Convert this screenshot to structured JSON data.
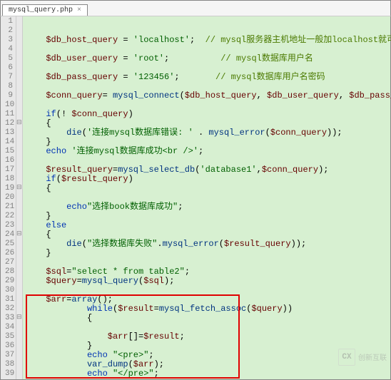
{
  "tab": {
    "label": "mysql_query.php",
    "close": "×"
  },
  "lines": [
    {
      "n": "1",
      "f": "",
      "segs": []
    },
    {
      "n": "2",
      "f": "",
      "segs": []
    },
    {
      "n": "3",
      "f": "",
      "segs": [
        {
          "t": "    ",
          "c": ""
        },
        {
          "t": "$db_host_query",
          "c": "c-var"
        },
        {
          "t": " = ",
          "c": "c-op"
        },
        {
          "t": "'localhost'",
          "c": "c-str"
        },
        {
          "t": ";  ",
          "c": "c-op"
        },
        {
          "t": "// mysql服务器主机地址一般加localhost就可以",
          "c": "c-cmt2"
        }
      ]
    },
    {
      "n": "4",
      "f": "",
      "segs": []
    },
    {
      "n": "5",
      "f": "",
      "segs": [
        {
          "t": "    ",
          "c": ""
        },
        {
          "t": "$db_user_query",
          "c": "c-var"
        },
        {
          "t": " = ",
          "c": "c-op"
        },
        {
          "t": "'root'",
          "c": "c-str"
        },
        {
          "t": ";          ",
          "c": "c-op"
        },
        {
          "t": "// mysql数据库用户名",
          "c": "c-cmt2"
        }
      ]
    },
    {
      "n": "6",
      "f": "",
      "segs": []
    },
    {
      "n": "7",
      "f": "",
      "segs": [
        {
          "t": "    ",
          "c": ""
        },
        {
          "t": "$db_pass_query",
          "c": "c-var"
        },
        {
          "t": " = ",
          "c": "c-op"
        },
        {
          "t": "'123456'",
          "c": "c-str"
        },
        {
          "t": ";       ",
          "c": "c-op"
        },
        {
          "t": "// mysql数据库用户名密码",
          "c": "c-cmt2"
        }
      ]
    },
    {
      "n": "8",
      "f": "",
      "segs": []
    },
    {
      "n": "9",
      "f": "",
      "segs": [
        {
          "t": "    ",
          "c": ""
        },
        {
          "t": "$conn_query",
          "c": "c-var"
        },
        {
          "t": "= ",
          "c": "c-op"
        },
        {
          "t": "mysql_connect",
          "c": "c-fn"
        },
        {
          "t": "(",
          "c": "c-op"
        },
        {
          "t": "$db_host_query",
          "c": "c-var"
        },
        {
          "t": ", ",
          "c": "c-op"
        },
        {
          "t": "$db_user_query",
          "c": "c-var"
        },
        {
          "t": ", ",
          "c": "c-op"
        },
        {
          "t": "$db_pass_query",
          "c": "c-var"
        },
        {
          "t": ");",
          "c": "c-op"
        }
      ]
    },
    {
      "n": "10",
      "f": "",
      "segs": []
    },
    {
      "n": "11",
      "f": "",
      "segs": [
        {
          "t": "    ",
          "c": ""
        },
        {
          "t": "if",
          "c": "c-kw"
        },
        {
          "t": "(! ",
          "c": "c-op"
        },
        {
          "t": "$conn_query",
          "c": "c-var"
        },
        {
          "t": ")",
          "c": "c-op"
        }
      ]
    },
    {
      "n": "12",
      "f": "⊟",
      "segs": [
        {
          "t": "    {",
          "c": "c-op"
        }
      ]
    },
    {
      "n": "13",
      "f": "",
      "segs": [
        {
          "t": "        ",
          "c": ""
        },
        {
          "t": "die",
          "c": "c-fn"
        },
        {
          "t": "(",
          "c": "c-op"
        },
        {
          "t": "'连接mysql数据库错误: '",
          "c": "c-str"
        },
        {
          "t": " . ",
          "c": "c-op"
        },
        {
          "t": "mysql_error",
          "c": "c-fn"
        },
        {
          "t": "(",
          "c": "c-op"
        },
        {
          "t": "$conn_query",
          "c": "c-var"
        },
        {
          "t": "));",
          "c": "c-op"
        }
      ]
    },
    {
      "n": "14",
      "f": "",
      "segs": [
        {
          "t": "    }",
          "c": "c-op"
        }
      ]
    },
    {
      "n": "15",
      "f": "",
      "segs": [
        {
          "t": "    ",
          "c": ""
        },
        {
          "t": "echo",
          "c": "c-kw"
        },
        {
          "t": " ",
          "c": ""
        },
        {
          "t": "'连接mysql数据库成功<br />'",
          "c": "c-str"
        },
        {
          "t": ";",
          "c": "c-op"
        }
      ]
    },
    {
      "n": "16",
      "f": "",
      "segs": []
    },
    {
      "n": "17",
      "f": "",
      "segs": [
        {
          "t": "    ",
          "c": ""
        },
        {
          "t": "$result_query",
          "c": "c-var"
        },
        {
          "t": "=",
          "c": "c-op"
        },
        {
          "t": "mysql_select_db",
          "c": "c-fn"
        },
        {
          "t": "(",
          "c": "c-op"
        },
        {
          "t": "'database1'",
          "c": "c-str"
        },
        {
          "t": ",",
          "c": "c-op"
        },
        {
          "t": "$conn_query",
          "c": "c-var"
        },
        {
          "t": ");",
          "c": "c-op"
        }
      ]
    },
    {
      "n": "18",
      "f": "",
      "segs": [
        {
          "t": "    ",
          "c": ""
        },
        {
          "t": "if",
          "c": "c-kw"
        },
        {
          "t": "(",
          "c": "c-op"
        },
        {
          "t": "$result_query",
          "c": "c-var"
        },
        {
          "t": ")",
          "c": "c-op"
        }
      ]
    },
    {
      "n": "19",
      "f": "⊟",
      "segs": [
        {
          "t": "    {",
          "c": "c-op"
        }
      ]
    },
    {
      "n": "20",
      "f": "",
      "segs": []
    },
    {
      "n": "21",
      "f": "",
      "segs": [
        {
          "t": "        ",
          "c": ""
        },
        {
          "t": "echo",
          "c": "c-kw"
        },
        {
          "t": "\"选择book数据库成功\"",
          "c": "c-str"
        },
        {
          "t": ";",
          "c": "c-op"
        }
      ]
    },
    {
      "n": "22",
      "f": "",
      "segs": [
        {
          "t": "    }",
          "c": "c-op"
        }
      ]
    },
    {
      "n": "23",
      "f": "",
      "segs": [
        {
          "t": "    ",
          "c": ""
        },
        {
          "t": "else",
          "c": "c-kw"
        }
      ]
    },
    {
      "n": "24",
      "f": "⊟",
      "segs": [
        {
          "t": "    {",
          "c": "c-op"
        }
      ]
    },
    {
      "n": "25",
      "f": "",
      "segs": [
        {
          "t": "        ",
          "c": ""
        },
        {
          "t": "die",
          "c": "c-fn"
        },
        {
          "t": "(",
          "c": "c-op"
        },
        {
          "t": "\"选择数据库失败\"",
          "c": "c-str"
        },
        {
          "t": ".",
          "c": "c-op"
        },
        {
          "t": "mysql_error",
          "c": "c-fn"
        },
        {
          "t": "(",
          "c": "c-op"
        },
        {
          "t": "$result_query",
          "c": "c-var"
        },
        {
          "t": "));",
          "c": "c-op"
        }
      ]
    },
    {
      "n": "26",
      "f": "",
      "segs": [
        {
          "t": "    }",
          "c": "c-op"
        }
      ]
    },
    {
      "n": "27",
      "f": "",
      "segs": []
    },
    {
      "n": "28",
      "f": "",
      "segs": [
        {
          "t": "    ",
          "c": ""
        },
        {
          "t": "$sql",
          "c": "c-var"
        },
        {
          "t": "=",
          "c": "c-op"
        },
        {
          "t": "\"select * from table2\"",
          "c": "c-str"
        },
        {
          "t": ";",
          "c": "c-op"
        }
      ]
    },
    {
      "n": "29",
      "f": "",
      "segs": [
        {
          "t": "    ",
          "c": ""
        },
        {
          "t": "$query",
          "c": "c-var"
        },
        {
          "t": "=",
          "c": "c-op"
        },
        {
          "t": "mysql_query",
          "c": "c-fn"
        },
        {
          "t": "(",
          "c": "c-op"
        },
        {
          "t": "$sql",
          "c": "c-var"
        },
        {
          "t": ");",
          "c": "c-op"
        }
      ]
    },
    {
      "n": "30",
      "f": "",
      "segs": []
    },
    {
      "n": "31",
      "f": "",
      "segs": [
        {
          "t": "    ",
          "c": ""
        },
        {
          "t": "$arr",
          "c": "c-var"
        },
        {
          "t": "=",
          "c": "c-op"
        },
        {
          "t": "array",
          "c": "c-fn"
        },
        {
          "t": "();",
          "c": "c-op"
        }
      ]
    },
    {
      "n": "32",
      "f": "",
      "segs": [
        {
          "t": "            ",
          "c": ""
        },
        {
          "t": "while",
          "c": "c-kw"
        },
        {
          "t": "(",
          "c": "c-op"
        },
        {
          "t": "$result",
          "c": "c-var"
        },
        {
          "t": "=",
          "c": "c-op"
        },
        {
          "t": "mysql_fetch_assoc",
          "c": "c-fn"
        },
        {
          "t": "(",
          "c": "c-op"
        },
        {
          "t": "$query",
          "c": "c-var"
        },
        {
          "t": "))",
          "c": "c-op"
        }
      ]
    },
    {
      "n": "33",
      "f": "⊟",
      "segs": [
        {
          "t": "            {",
          "c": "c-op"
        }
      ]
    },
    {
      "n": "34",
      "f": "",
      "segs": []
    },
    {
      "n": "35",
      "f": "",
      "segs": [
        {
          "t": "                ",
          "c": ""
        },
        {
          "t": "$arr",
          "c": "c-var"
        },
        {
          "t": "[]=",
          "c": "c-op"
        },
        {
          "t": "$result",
          "c": "c-var"
        },
        {
          "t": ";",
          "c": "c-op"
        }
      ]
    },
    {
      "n": "36",
      "f": "",
      "segs": [
        {
          "t": "            }",
          "c": "c-op"
        }
      ]
    },
    {
      "n": "37",
      "f": "",
      "segs": [
        {
          "t": "            ",
          "c": ""
        },
        {
          "t": "echo",
          "c": "c-kw"
        },
        {
          "t": " ",
          "c": ""
        },
        {
          "t": "\"<pre>\"",
          "c": "c-str"
        },
        {
          "t": ";",
          "c": "c-op"
        }
      ]
    },
    {
      "n": "38",
      "f": "",
      "segs": [
        {
          "t": "            ",
          "c": ""
        },
        {
          "t": "var_dump",
          "c": "c-fn"
        },
        {
          "t": "(",
          "c": "c-op"
        },
        {
          "t": "$arr",
          "c": "c-var"
        },
        {
          "t": ");",
          "c": "c-op"
        }
      ]
    },
    {
      "n": "39",
      "f": "",
      "segs": [
        {
          "t": "            ",
          "c": ""
        },
        {
          "t": "echo",
          "c": "c-kw"
        },
        {
          "t": " ",
          "c": ""
        },
        {
          "t": "\"</pre>\"",
          "c": "c-str"
        },
        {
          "t": ";",
          "c": "c-op"
        }
      ]
    }
  ],
  "watermark": {
    "logo": "CX",
    "text": "创新互联"
  }
}
